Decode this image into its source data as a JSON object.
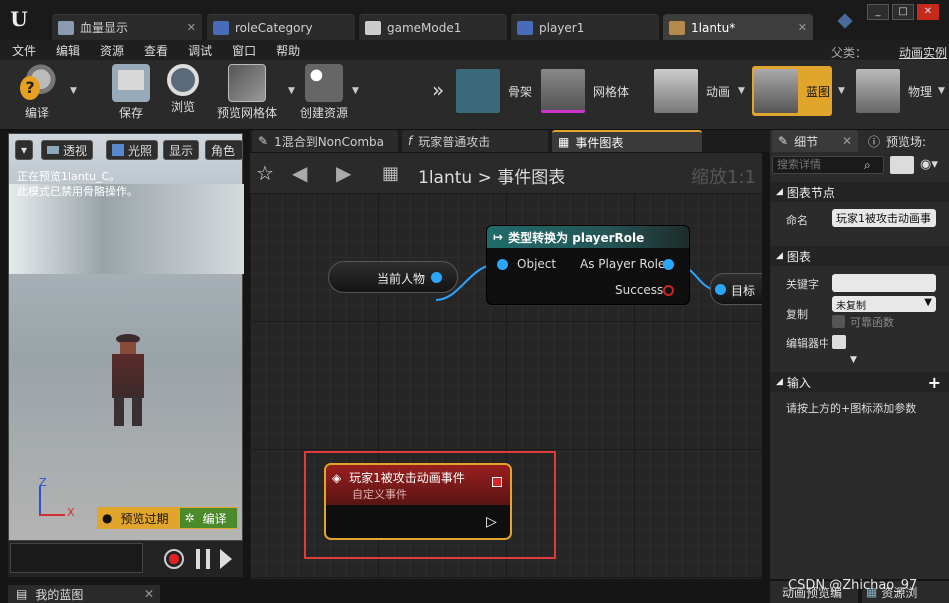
{
  "window": {
    "tabs": [
      {
        "label": "血量显示",
        "active": false
      },
      {
        "label": "roleCategory",
        "active": false
      },
      {
        "label": "gameMode1",
        "active": false
      },
      {
        "label": "player1",
        "active": false
      },
      {
        "label": "1lantu*",
        "active": true
      }
    ],
    "controls": [
      "_",
      "□",
      "✕"
    ]
  },
  "menu": {
    "items": [
      "文件",
      "编辑",
      "资源",
      "查看",
      "调试",
      "窗口",
      "帮助"
    ],
    "parent_label": "父类：",
    "parent_value": "动画实例"
  },
  "toolbar": {
    "compile": "编译",
    "save": "保存",
    "browse": "浏览",
    "preview_mesh": "预览网格体",
    "create_asset": "创建资源",
    "overflow": "»"
  },
  "modes": [
    {
      "label": "骨架",
      "active": false
    },
    {
      "label": "网格体",
      "active": false
    },
    {
      "label": "动画",
      "active": false
    },
    {
      "label": "蓝图",
      "active": true
    },
    {
      "label": "物理",
      "active": false
    }
  ],
  "viewport": {
    "menu_btn": "▾",
    "perspective": "透视",
    "lighting": "光照",
    "show": "显示",
    "character": "角色",
    "info_line1": "正在预览1lantu_C。",
    "info_line2": "此模式已禁用骨骼操作。",
    "axis_z": "Z",
    "axis_x": "X",
    "preview_outdated": "预览过期",
    "compile": "编译"
  },
  "my_blueprint": "我的蓝图",
  "graph_tabs": [
    {
      "label": "1混合到NonComba",
      "active": false
    },
    {
      "label": "玩家普通攻击",
      "active": false
    },
    {
      "label": "事件图表",
      "active": true
    }
  ],
  "graph_header": {
    "asset": "1lantu",
    "separator": ">",
    "graph": "事件图表",
    "zoom": "缩放1:1"
  },
  "nodes": {
    "current_character": {
      "label": "当前人物"
    },
    "cast": {
      "title": "类型转换为 playerRole",
      "input_pin": "Object",
      "output_pin": "As Player Role",
      "success_pin": "Success"
    },
    "target_stub": {
      "label": "目标"
    },
    "custom_event": {
      "title": "玩家1被攻击动画事件",
      "subtitle": "自定义事件"
    }
  },
  "details": {
    "tab_details": "细节",
    "tab_preview": "预览场:",
    "search_placeholder": "搜索详情",
    "section_node": "图表节点",
    "name_label": "命名",
    "name_value": "玩家1被攻击动画事",
    "section_graph": "图表",
    "keywords_label": "关键字",
    "keywords_value": "",
    "replicate_label": "复制",
    "replicate_value": "未复制",
    "reliable_label": "可靠函数",
    "editor_label": "编辑器中",
    "section_inputs": "输入",
    "inputs_hint": "请按上方的+图标添加参数",
    "add": "+"
  },
  "status": {
    "anim_preview": "动画预览编",
    "asset_browser": "资源浏",
    "watermark": "CSDN @Zhichao_97"
  },
  "colors": {
    "accent_orange": "#e2a52c",
    "selection_red": "#e03b3b",
    "pin_blue": "#2aa6ff",
    "cast_header": "#1f6b6b",
    "event_header": "#8a1c1c"
  }
}
